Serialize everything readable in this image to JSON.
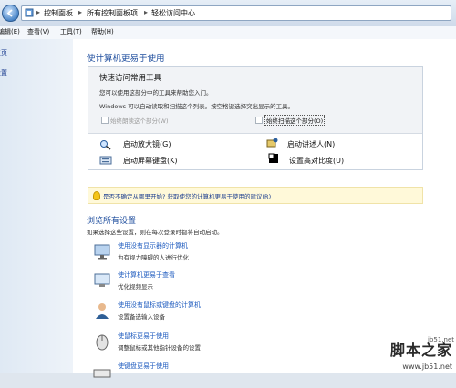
{
  "breadcrumb": [
    "控制面板",
    "所有控制面板项",
    "轻松访问中心"
  ],
  "menu": [
    "编辑(E)",
    "查看(V)",
    "工具(T)",
    "帮助(H)"
  ],
  "left_links": [
    "主页",
    "设置"
  ],
  "main": {
    "heading": "使计算机更易于使用",
    "quick": {
      "title": "快速访问常用工具",
      "line1": "您可以使用这部分中的工具来帮助您入门。",
      "line2": "Windows 可以自动读取和扫描这个列表。按空格键选择突出显示的工具。",
      "cb1": "始终朗读这个部分(W)",
      "cb2": "始终扫描这个部分(O)",
      "tools": [
        "启动放大镜(G)",
        "启动讲述人(N)",
        "启动屏幕键盘(K)",
        "设置高对比度(U)"
      ]
    },
    "tip": "是否不确定从哪里开始? 获取使您的计算机更易于使用的建议(R)",
    "browse": {
      "heading": "浏览所有设置",
      "sub": "如果选择这些设置，则在每次登录时都将自动启动。",
      "items": [
        {
          "link": "使用没有显示器的计算机",
          "desc": "为有视力障碍的人进行优化"
        },
        {
          "link": "使计算机更易于查看",
          "desc": "优化视频显示"
        },
        {
          "link": "使用没有鼠标或键盘的计算机",
          "desc": "设置备选输入设备"
        },
        {
          "link": "使鼠标更易于使用",
          "desc": "调整鼠标或其他指针设备的设置"
        },
        {
          "link": "使键盘更易于使用",
          "desc": ""
        }
      ]
    }
  },
  "watermark": {
    "line0": "jb51.net",
    "line1": "脚本之家",
    "line2": "www.jb51.net"
  }
}
